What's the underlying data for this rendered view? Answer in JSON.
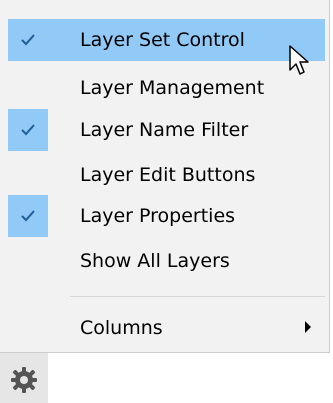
{
  "menu": {
    "items": [
      {
        "label": "Layer Set Control",
        "checked": true,
        "highlighted": true
      },
      {
        "label": "Layer Management",
        "checked": false,
        "highlighted": false
      },
      {
        "label": "Layer Name Filter",
        "checked": true,
        "highlighted": false
      },
      {
        "label": "Layer Edit Buttons",
        "checked": false,
        "highlighted": false
      },
      {
        "label": "Layer Properties",
        "checked": true,
        "highlighted": false
      },
      {
        "label": "Show All Layers",
        "checked": false,
        "highlighted": false
      }
    ],
    "submenu": {
      "label": "Columns",
      "has_submenu": true
    }
  },
  "colors": {
    "highlight": "#91c9f7",
    "check_bg": "#91c9f7",
    "menu_bg": "#f2f2f2",
    "gear_button_bg": "#e6e6e6"
  },
  "icons": {
    "check": "check-icon",
    "cursor": "mouse-pointer-icon",
    "submenu": "chevron-right-icon",
    "gear": "gear-icon"
  }
}
